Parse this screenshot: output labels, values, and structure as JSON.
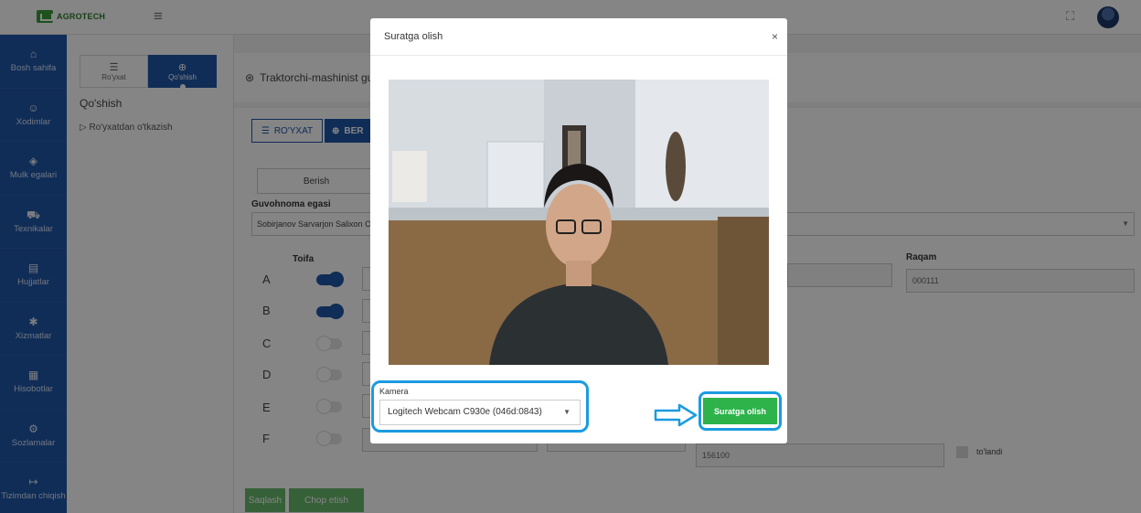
{
  "topbar": {
    "logo_text": "AGROTECH"
  },
  "sidebar": {
    "items": [
      {
        "label": "Bosh sahifa",
        "icon": "home-icon"
      },
      {
        "label": "Xodimlar",
        "icon": "user-icon"
      },
      {
        "label": "Mulk egalari",
        "icon": "cube-icon"
      },
      {
        "label": "Texnikalar",
        "icon": "tractor-icon"
      },
      {
        "label": "Hujjatlar",
        "icon": "document-icon"
      },
      {
        "label": "Xizmatlar",
        "icon": "gears-icon"
      },
      {
        "label": "Hisobotlar",
        "icon": "report-icon"
      },
      {
        "label": "Sozlamalar",
        "icon": "settings-icon"
      },
      {
        "label": "Tizimdan chiqish",
        "icon": "logout-icon"
      }
    ]
  },
  "subsidebar": {
    "tabs": [
      {
        "label": "Ro'yxat",
        "icon": "list-icon"
      },
      {
        "label": "Qo'shish",
        "icon": "plus-circle-icon"
      }
    ],
    "heading": "Qo'shish",
    "link": "Ro'yxatdan o'tkazish"
  },
  "main": {
    "page_title": "Traktorchi-mashinist guv",
    "btn_list": "RO'YXAT",
    "btn_give": "BER",
    "berish": "Berish",
    "owner_label": "Guvohnoma egasi",
    "owner_value": "Sobirjanov Sarvarjon Salixon O`g",
    "toifa_label": "Toifa",
    "categories": [
      {
        "letter": "A",
        "on": true
      },
      {
        "letter": "B",
        "on": true
      },
      {
        "letter": "C",
        "on": false
      },
      {
        "letter": "D",
        "on": false
      },
      {
        "letter": "E",
        "on": false
      },
      {
        "letter": "F",
        "on": false
      }
    ],
    "raqam_label": "Raqam",
    "raqam_value": "000111",
    "amount_value": "156100",
    "paid_label": "to'landi",
    "save_label": "Saqlash",
    "print_label": "Chop etish"
  },
  "modal": {
    "title": "Suratga olish",
    "close": "×",
    "camera_label": "Kamera",
    "camera_value": "Logitech Webcam C930e (046d:0843)",
    "capture_label": "Suratga olish"
  },
  "colors": {
    "sidebar": "#1f56a8",
    "primary": "#1f56a8",
    "capture_button": "#2db34a",
    "highlight": "#1b9be0"
  }
}
